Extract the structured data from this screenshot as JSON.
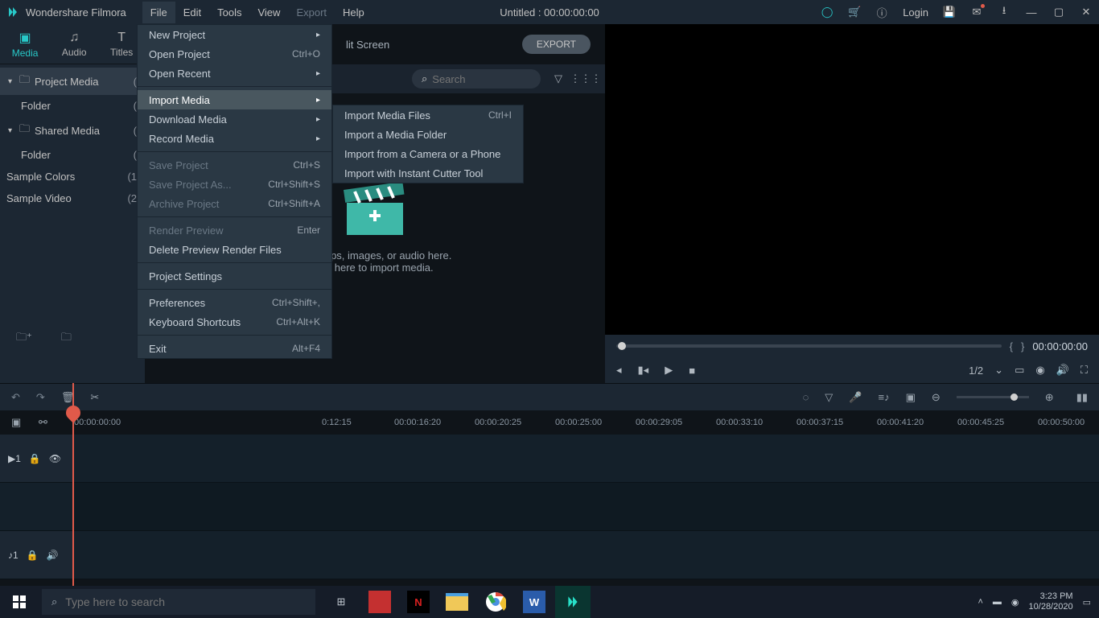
{
  "app": {
    "name": "Wondershare Filmora",
    "title": "Untitled : 00:00:00:00",
    "login": "Login"
  },
  "menubar": [
    "File",
    "Edit",
    "Tools",
    "View",
    "Export",
    "Help"
  ],
  "tabs": {
    "media": "Media",
    "audio": "Audio",
    "titles": "Titles"
  },
  "mid": {
    "split": "lit Screen",
    "export": "EXPORT",
    "search_ph": "Search"
  },
  "tree": {
    "project": {
      "label": "Project Media",
      "count": "("
    },
    "folder1": {
      "label": "Folder",
      "count": "("
    },
    "shared": {
      "label": "Shared Media",
      "count": "("
    },
    "folder2": {
      "label": "Folder",
      "count": "("
    },
    "colors": {
      "label": "Sample Colors",
      "count": "(1"
    },
    "video": {
      "label": "Sample Video",
      "count": "(2"
    }
  },
  "drop": {
    "line1": "ideo clips, images, or audio here.",
    "line2": "lick here to import media."
  },
  "preview": {
    "brL": "{",
    "brR": "}",
    "time": "00:00:00:00",
    "ratio": "1/2"
  },
  "ruler": [
    "00:00:00:00",
    "0:12:15",
    "00:00:16:20",
    "00:00:20:25",
    "00:00:25:00",
    "00:00:29:05",
    "00:00:33:10",
    "00:00:37:15",
    "00:00:41:20",
    "00:00:45:25",
    "00:00:50:00"
  ],
  "file_menu": {
    "new": "New Project",
    "open": "Open Project",
    "open_sc": "Ctrl+O",
    "recent": "Open Recent",
    "import": "Import Media",
    "download": "Download Media",
    "record": "Record Media",
    "save": "Save Project",
    "save_sc": "Ctrl+S",
    "saveas": "Save Project As...",
    "saveas_sc": "Ctrl+Shift+S",
    "archive": "Archive Project",
    "archive_sc": "Ctrl+Shift+A",
    "render": "Render Preview",
    "render_sc": "Enter",
    "delrender": "Delete Preview Render Files",
    "settings": "Project Settings",
    "prefs": "Preferences",
    "prefs_sc": "Ctrl+Shift+,",
    "kb": "Keyboard Shortcuts",
    "kb_sc": "Ctrl+Alt+K",
    "exit": "Exit",
    "exit_sc": "Alt+F4"
  },
  "submenu": {
    "files": "Import Media Files",
    "files_sc": "Ctrl+I",
    "folder": "Import a Media Folder",
    "camera": "Import from a Camera or a Phone",
    "cutter": "Import with Instant Cutter Tool"
  },
  "taskbar": {
    "search_ph": "Type here to search",
    "time": "3:23 PM",
    "date": "10/28/2020"
  }
}
